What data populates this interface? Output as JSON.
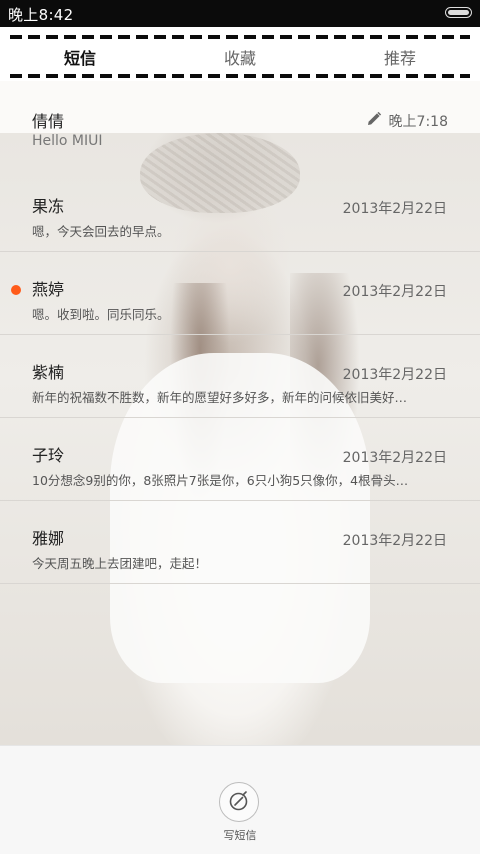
{
  "status_bar": {
    "time": "晚上8:42",
    "battery_level": 1.0
  },
  "tabs": [
    {
      "label": "短信",
      "active": true
    },
    {
      "label": "收藏",
      "active": false
    },
    {
      "label": "推荐",
      "active": false
    }
  ],
  "pinned": {
    "name": "倩倩",
    "time": "晚上7:18",
    "preview": "Hello MIUI",
    "icon": "pencil-icon"
  },
  "messages": [
    {
      "name": "果冻",
      "date": "2013年2月22日",
      "preview": "嗯，今天会回去的早点。",
      "unread": false
    },
    {
      "name": "燕婷",
      "date": "2013年2月22日",
      "preview": "嗯。收到啦。同乐同乐。",
      "unread": true
    },
    {
      "name": "紫楠",
      "date": "2013年2月22日",
      "preview": "新年的祝福数不胜数，新年的愿望好多好多，新年的问候依旧美好…",
      "unread": false
    },
    {
      "name": "子玲",
      "date": "2013年2月22日",
      "preview": "10分想念9别的你，8张照片7张是你，6只小狗5只像你，4根骨头…",
      "unread": false
    },
    {
      "name": "雅娜",
      "date": "2013年2月22日",
      "preview": "今天周五晚上去团建吧，走起！",
      "unread": false
    }
  ],
  "bottom": {
    "compose_label": "写短信",
    "compose_icon": "compose-icon"
  },
  "colors": {
    "unread": "#ff5b1a",
    "status_bar": "#0b0b0b"
  }
}
